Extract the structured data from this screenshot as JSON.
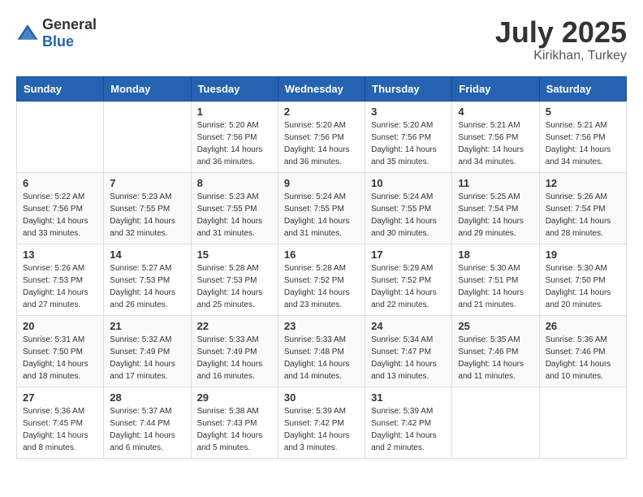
{
  "logo": {
    "general": "General",
    "blue": "Blue"
  },
  "title": {
    "month": "July 2025",
    "location": "Kirikhan, Turkey"
  },
  "headers": [
    "Sunday",
    "Monday",
    "Tuesday",
    "Wednesday",
    "Thursday",
    "Friday",
    "Saturday"
  ],
  "weeks": [
    [
      {
        "day": "",
        "content": ""
      },
      {
        "day": "",
        "content": ""
      },
      {
        "day": "1",
        "sunrise": "Sunrise: 5:20 AM",
        "sunset": "Sunset: 7:56 PM",
        "daylight": "Daylight: 14 hours and 36 minutes."
      },
      {
        "day": "2",
        "sunrise": "Sunrise: 5:20 AM",
        "sunset": "Sunset: 7:56 PM",
        "daylight": "Daylight: 14 hours and 36 minutes."
      },
      {
        "day": "3",
        "sunrise": "Sunrise: 5:20 AM",
        "sunset": "Sunset: 7:56 PM",
        "daylight": "Daylight: 14 hours and 35 minutes."
      },
      {
        "day": "4",
        "sunrise": "Sunrise: 5:21 AM",
        "sunset": "Sunset: 7:56 PM",
        "daylight": "Daylight: 14 hours and 34 minutes."
      },
      {
        "day": "5",
        "sunrise": "Sunrise: 5:21 AM",
        "sunset": "Sunset: 7:56 PM",
        "daylight": "Daylight: 14 hours and 34 minutes."
      }
    ],
    [
      {
        "day": "6",
        "sunrise": "Sunrise: 5:22 AM",
        "sunset": "Sunset: 7:56 PM",
        "daylight": "Daylight: 14 hours and 33 minutes."
      },
      {
        "day": "7",
        "sunrise": "Sunrise: 5:23 AM",
        "sunset": "Sunset: 7:55 PM",
        "daylight": "Daylight: 14 hours and 32 minutes."
      },
      {
        "day": "8",
        "sunrise": "Sunrise: 5:23 AM",
        "sunset": "Sunset: 7:55 PM",
        "daylight": "Daylight: 14 hours and 31 minutes."
      },
      {
        "day": "9",
        "sunrise": "Sunrise: 5:24 AM",
        "sunset": "Sunset: 7:55 PM",
        "daylight": "Daylight: 14 hours and 31 minutes."
      },
      {
        "day": "10",
        "sunrise": "Sunrise: 5:24 AM",
        "sunset": "Sunset: 7:55 PM",
        "daylight": "Daylight: 14 hours and 30 minutes."
      },
      {
        "day": "11",
        "sunrise": "Sunrise: 5:25 AM",
        "sunset": "Sunset: 7:54 PM",
        "daylight": "Daylight: 14 hours and 29 minutes."
      },
      {
        "day": "12",
        "sunrise": "Sunrise: 5:26 AM",
        "sunset": "Sunset: 7:54 PM",
        "daylight": "Daylight: 14 hours and 28 minutes."
      }
    ],
    [
      {
        "day": "13",
        "sunrise": "Sunrise: 5:26 AM",
        "sunset": "Sunset: 7:53 PM",
        "daylight": "Daylight: 14 hours and 27 minutes."
      },
      {
        "day": "14",
        "sunrise": "Sunrise: 5:27 AM",
        "sunset": "Sunset: 7:53 PM",
        "daylight": "Daylight: 14 hours and 26 minutes."
      },
      {
        "day": "15",
        "sunrise": "Sunrise: 5:28 AM",
        "sunset": "Sunset: 7:53 PM",
        "daylight": "Daylight: 14 hours and 25 minutes."
      },
      {
        "day": "16",
        "sunrise": "Sunrise: 5:28 AM",
        "sunset": "Sunset: 7:52 PM",
        "daylight": "Daylight: 14 hours and 23 minutes."
      },
      {
        "day": "17",
        "sunrise": "Sunrise: 5:29 AM",
        "sunset": "Sunset: 7:52 PM",
        "daylight": "Daylight: 14 hours and 22 minutes."
      },
      {
        "day": "18",
        "sunrise": "Sunrise: 5:30 AM",
        "sunset": "Sunset: 7:51 PM",
        "daylight": "Daylight: 14 hours and 21 minutes."
      },
      {
        "day": "19",
        "sunrise": "Sunrise: 5:30 AM",
        "sunset": "Sunset: 7:50 PM",
        "daylight": "Daylight: 14 hours and 20 minutes."
      }
    ],
    [
      {
        "day": "20",
        "sunrise": "Sunrise: 5:31 AM",
        "sunset": "Sunset: 7:50 PM",
        "daylight": "Daylight: 14 hours and 18 minutes."
      },
      {
        "day": "21",
        "sunrise": "Sunrise: 5:32 AM",
        "sunset": "Sunset: 7:49 PM",
        "daylight": "Daylight: 14 hours and 17 minutes."
      },
      {
        "day": "22",
        "sunrise": "Sunrise: 5:33 AM",
        "sunset": "Sunset: 7:49 PM",
        "daylight": "Daylight: 14 hours and 16 minutes."
      },
      {
        "day": "23",
        "sunrise": "Sunrise: 5:33 AM",
        "sunset": "Sunset: 7:48 PM",
        "daylight": "Daylight: 14 hours and 14 minutes."
      },
      {
        "day": "24",
        "sunrise": "Sunrise: 5:34 AM",
        "sunset": "Sunset: 7:47 PM",
        "daylight": "Daylight: 14 hours and 13 minutes."
      },
      {
        "day": "25",
        "sunrise": "Sunrise: 5:35 AM",
        "sunset": "Sunset: 7:46 PM",
        "daylight": "Daylight: 14 hours and 11 minutes."
      },
      {
        "day": "26",
        "sunrise": "Sunrise: 5:36 AM",
        "sunset": "Sunset: 7:46 PM",
        "daylight": "Daylight: 14 hours and 10 minutes."
      }
    ],
    [
      {
        "day": "27",
        "sunrise": "Sunrise: 5:36 AM",
        "sunset": "Sunset: 7:45 PM",
        "daylight": "Daylight: 14 hours and 8 minutes."
      },
      {
        "day": "28",
        "sunrise": "Sunrise: 5:37 AM",
        "sunset": "Sunset: 7:44 PM",
        "daylight": "Daylight: 14 hours and 6 minutes."
      },
      {
        "day": "29",
        "sunrise": "Sunrise: 5:38 AM",
        "sunset": "Sunset: 7:43 PM",
        "daylight": "Daylight: 14 hours and 5 minutes."
      },
      {
        "day": "30",
        "sunrise": "Sunrise: 5:39 AM",
        "sunset": "Sunset: 7:42 PM",
        "daylight": "Daylight: 14 hours and 3 minutes."
      },
      {
        "day": "31",
        "sunrise": "Sunrise: 5:39 AM",
        "sunset": "Sunset: 7:42 PM",
        "daylight": "Daylight: 14 hours and 2 minutes."
      },
      {
        "day": "",
        "content": ""
      },
      {
        "day": "",
        "content": ""
      }
    ]
  ]
}
